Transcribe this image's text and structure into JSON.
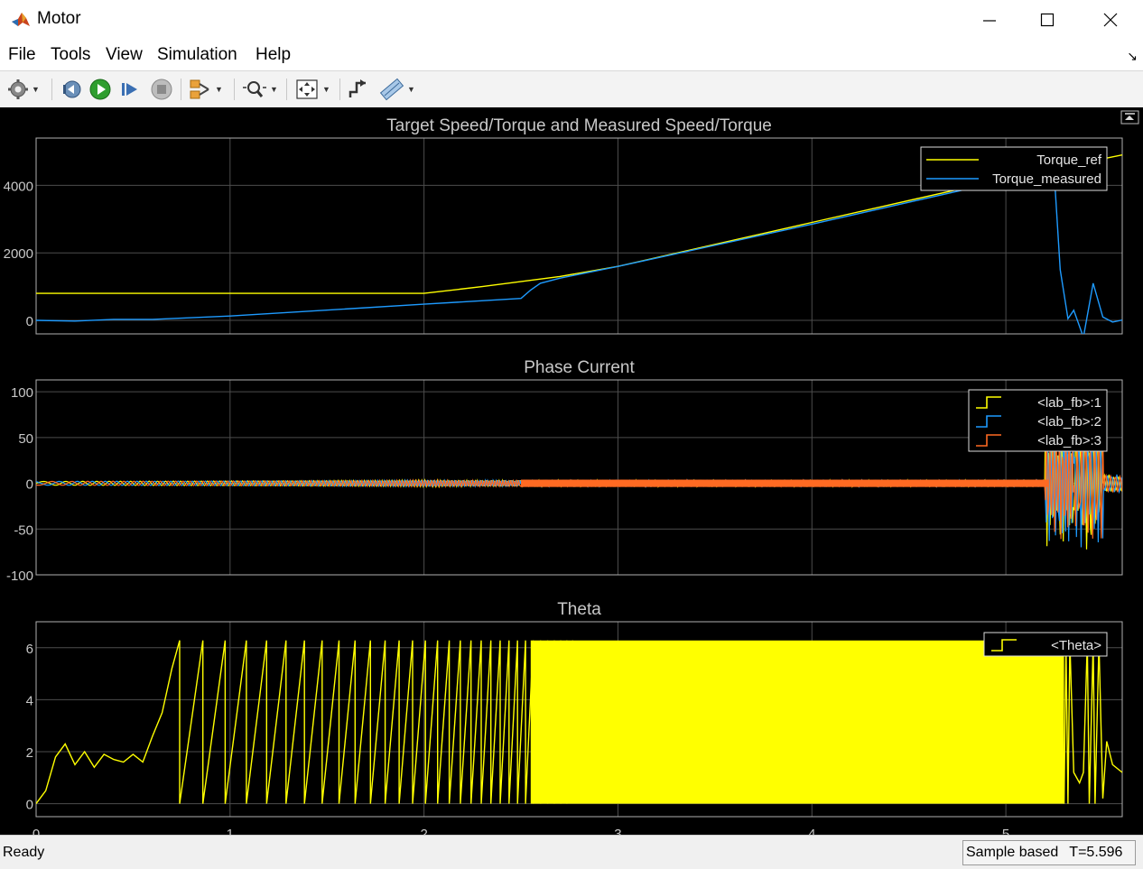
{
  "window": {
    "title": "Motor"
  },
  "menu": [
    "File",
    "Tools",
    "View",
    "Simulation",
    "Help"
  ],
  "status": {
    "state": "Ready",
    "mode": "Sample based",
    "time": "T=5.596"
  },
  "colors": {
    "yellow": "#ffff00",
    "blue": "#1e9bff",
    "orange": "#ff6a22",
    "grid": "#4d4d4d",
    "axis": "#b0b0b0"
  },
  "chart_data": [
    {
      "type": "line",
      "title": "Target Speed/Torque and Measured Speed/Torque",
      "xlim": [
        0,
        5.6
      ],
      "ylim": [
        -400,
        5400
      ],
      "yticks": [
        0,
        2000,
        4000
      ],
      "ytick_labels": [
        "0",
        "2000",
        "4000"
      ],
      "legend": "top-right",
      "series": [
        {
          "name": "Torque_ref",
          "x": [
            0,
            2.0,
            2.3,
            2.7,
            3.0,
            4.0,
            5.0,
            5.6
          ],
          "y": [
            800,
            800,
            1000,
            1300,
            1600,
            2900,
            4200,
            4900
          ]
        },
        {
          "name": "Torque_measured",
          "x": [
            0,
            0.2,
            0.4,
            0.6,
            1.0,
            2.0,
            2.5,
            2.55,
            2.6,
            2.7,
            3.0,
            4.0,
            5.0,
            5.25,
            5.28,
            5.32,
            5.35,
            5.4,
            5.45,
            5.5,
            5.55,
            5.6
          ],
          "y": [
            0,
            -20,
            30,
            30,
            130,
            480,
            650,
            900,
            1100,
            1250,
            1600,
            2850,
            4150,
            4300,
            1500,
            50,
            300,
            -500,
            1100,
            100,
            -50,
            10
          ]
        }
      ]
    },
    {
      "type": "line",
      "title": "Phase Current",
      "xlim": [
        0,
        5.6
      ],
      "ylim": [
        -100,
        113
      ],
      "yticks": [
        -100,
        -50,
        0,
        50,
        100
      ],
      "ytick_labels": [
        "-100",
        "-50",
        "0",
        "50",
        "100"
      ],
      "legend": "top-right",
      "series": [
        {
          "name": "<lab_fb>:1"
        },
        {
          "name": "<lab_fb>:2"
        },
        {
          "name": "<lab_fb>:3"
        }
      ]
    },
    {
      "type": "line",
      "title": "Theta",
      "xlim": [
        0,
        5.6
      ],
      "ylim": [
        -0.5,
        7.0
      ],
      "yticks": [
        0,
        2,
        4,
        6
      ],
      "ytick_labels": [
        "0",
        "2",
        "4",
        "6"
      ],
      "xticks": [
        0,
        1,
        2,
        3,
        4,
        5
      ],
      "xtick_labels": [
        "0",
        "1",
        "2",
        "3",
        "4",
        "5"
      ],
      "legend": "top-right",
      "series": [
        {
          "name": "<Theta>",
          "x": [
            0,
            0.05,
            0.1,
            0.15,
            0.2,
            0.25,
            0.3,
            0.35,
            0.4,
            0.45,
            0.5,
            0.55,
            0.6,
            0.65,
            0.7,
            0.74
          ],
          "y": [
            0,
            0.5,
            1.8,
            2.3,
            1.5,
            2.0,
            1.4,
            1.9,
            1.7,
            1.6,
            1.9,
            1.6,
            2.6,
            3.5,
            5.2,
            6.28
          ]
        }
      ]
    }
  ]
}
